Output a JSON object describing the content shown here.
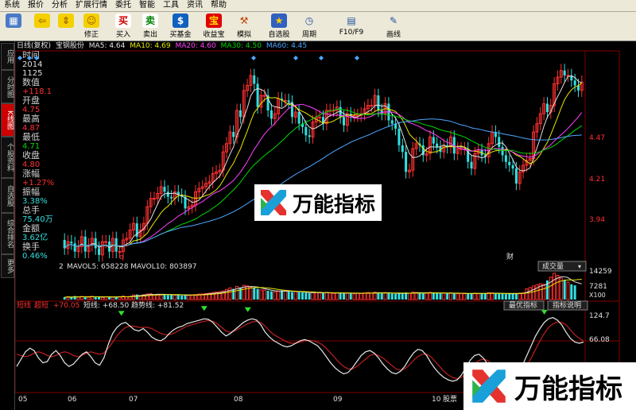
{
  "menu": [
    "系统",
    "报价",
    "分析",
    "扩展行情",
    "委托",
    "智能",
    "工具",
    "资讯",
    "帮助"
  ],
  "toolbar": [
    {
      "label": "",
      "icon": "layout-icon"
    },
    {
      "label": "",
      "icon": "back-arrow-icon"
    },
    {
      "label": "",
      "icon": "up-down-icon"
    },
    {
      "label": "修正",
      "icon": "smiley-icon"
    },
    {
      "label": "买入",
      "icon": "buy-icon"
    },
    {
      "label": "卖出",
      "icon": "sell-icon"
    },
    {
      "label": "买基金",
      "icon": "fund-icon"
    },
    {
      "label": "收益宝",
      "icon": "bao-icon"
    },
    {
      "label": "模拟",
      "icon": "hammer-icon"
    },
    {
      "label": "自选股",
      "icon": "star-icon"
    },
    {
      "label": "周期",
      "icon": "clock-icon"
    },
    {
      "label": "F10/F9",
      "icon": "grid-icon"
    },
    {
      "label": "画线",
      "icon": "pencil-icon"
    }
  ],
  "left_tabs": [
    "应用",
    "分时图",
    "K线图",
    "个股资料",
    "自选股",
    "综合排名",
    "更多"
  ],
  "ma_bar": {
    "period": "日线(复权)",
    "stock": "宝钢股份",
    "ma5": "MA5: 4.64",
    "ma10": "MA10: 4.69",
    "ma20": "MA20: 4.60",
    "ma30": "MA30: 4.50",
    "ma60": "MA60: 4.45"
  },
  "info": {
    "time_label": "时间",
    "year": "2014",
    "date": "1125",
    "value_label": "数值",
    "value": "+118.1",
    "open_label": "开盘",
    "open": "4.75",
    "high_label": "最高",
    "high": "4.87",
    "low_label": "最低",
    "low": "4.71",
    "close_label": "收盘",
    "close": "4.80",
    "change_label": "涨幅",
    "change": "+1.27%",
    "amp_label": "振幅",
    "amp": "3.38%",
    "vol_label": "总手",
    "vol": "75.40万",
    "amount_label": "金额",
    "amount": "3.62亿",
    "turnover_label": "换手",
    "turnover": "0.46%"
  },
  "price_axis": [
    "4.47",
    "4.21",
    "3.94"
  ],
  "volume_bar": {
    "index": "2",
    "mavol": "MAVOL5: 658228 MAVOL10: 803897",
    "select": "成交量",
    "axis": [
      "14259",
      "7281",
      "X100"
    ]
  },
  "indicator_bar": {
    "name": "短线",
    "name2": "超短",
    "value": "+70.05",
    "short_line": "短线: +68.50",
    "trend_line": "趋势线: +81.52",
    "btn_best": "最优指标",
    "btn_explain": "指标说明",
    "axis": [
      "124.7",
      "66.08"
    ]
  },
  "markers": {
    "q": "q",
    "cai": "财"
  },
  "x_axis": [
    "05",
    "06",
    "07",
    "08",
    "09",
    "10"
  ],
  "x_axis_tail": "股票",
  "watermark": "万能指标",
  "colors": {
    "up": "#ff3030",
    "down": "#30e0e0",
    "ma5": "#e0e0e0",
    "ma10": "#e8e800",
    "ma20": "#ff40ff",
    "ma30": "#00d800",
    "ma60": "#4da6ff"
  },
  "chart_data": {
    "type": "candlestick",
    "title": "宝钢股份",
    "ylim": [
      3.85,
      4.95
    ],
    "opens": [
      3.85,
      3.8,
      3.84,
      3.83,
      3.78,
      3.81,
      3.87,
      3.78,
      3.82,
      3.86,
      3.8,
      3.76,
      3.84,
      3.84,
      3.78,
      3.86,
      3.78,
      3.78,
      3.85,
      3.86,
      3.91,
      3.95,
      3.87,
      3.91,
      3.95,
      4.05,
      4.1,
      4.1,
      4.13,
      4.17,
      4.14,
      4.11,
      4.1,
      4.14,
      4.12,
      4.11,
      4.04,
      4.05,
      4.06,
      4.14,
      4.16,
      4.17,
      4.19,
      4.2,
      4.25,
      4.26,
      4.27,
      4.38,
      4.43,
      4.5,
      4.47,
      4.63,
      4.59,
      4.75,
      4.78,
      4.84,
      4.79,
      4.65,
      4.72,
      4.72,
      4.63,
      4.58,
      4.61,
      4.7,
      4.69,
      4.69,
      4.68,
      4.59,
      4.62,
      4.55,
      4.53,
      4.48,
      4.47,
      4.56,
      4.59,
      4.59,
      4.55,
      4.63,
      4.63,
      4.63,
      4.65,
      4.59,
      4.54,
      4.61,
      4.6,
      4.6,
      4.6,
      4.61,
      4.64,
      4.66,
      4.66,
      4.72,
      4.63,
      4.61,
      4.67,
      4.57,
      4.55,
      4.52,
      4.42,
      4.38,
      4.26,
      4.27,
      4.4,
      4.43,
      4.42,
      4.36,
      4.37,
      4.47,
      4.43,
      4.41,
      4.38,
      4.42,
      4.41,
      4.47,
      4.37,
      4.4,
      4.4,
      4.4,
      4.32,
      4.28,
      4.37,
      4.39,
      4.36,
      4.35,
      4.43,
      4.5,
      4.47,
      4.41,
      4.36,
      4.32,
      4.3,
      4.28,
      4.19,
      4.26,
      4.3,
      4.33,
      4.34,
      4.5,
      4.55,
      4.61,
      4.67,
      4.62,
      4.66,
      4.79,
      4.83,
      4.87,
      4.84,
      4.84,
      4.81,
      4.78,
      4.75
    ],
    "closes": [
      3.8,
      3.84,
      3.83,
      3.78,
      3.81,
      3.87,
      3.78,
      3.82,
      3.86,
      3.8,
      3.76,
      3.84,
      3.84,
      3.78,
      3.86,
      3.78,
      3.78,
      3.85,
      3.86,
      3.91,
      3.95,
      3.87,
      3.91,
      3.95,
      4.05,
      4.1,
      4.1,
      4.13,
      4.17,
      4.14,
      4.11,
      4.1,
      4.14,
      4.12,
      4.11,
      4.04,
      4.05,
      4.06,
      4.14,
      4.16,
      4.17,
      4.19,
      4.2,
      4.25,
      4.26,
      4.27,
      4.38,
      4.43,
      4.5,
      4.47,
      4.63,
      4.59,
      4.75,
      4.78,
      4.84,
      4.79,
      4.65,
      4.72,
      4.72,
      4.63,
      4.58,
      4.61,
      4.7,
      4.69,
      4.69,
      4.68,
      4.59,
      4.62,
      4.55,
      4.53,
      4.48,
      4.47,
      4.56,
      4.59,
      4.59,
      4.55,
      4.63,
      4.63,
      4.63,
      4.65,
      4.59,
      4.54,
      4.61,
      4.6,
      4.6,
      4.6,
      4.61,
      4.64,
      4.66,
      4.66,
      4.72,
      4.63,
      4.61,
      4.67,
      4.57,
      4.55,
      4.52,
      4.42,
      4.38,
      4.26,
      4.27,
      4.4,
      4.43,
      4.42,
      4.36,
      4.37,
      4.47,
      4.43,
      4.41,
      4.38,
      4.42,
      4.41,
      4.47,
      4.37,
      4.4,
      4.4,
      4.4,
      4.32,
      4.28,
      4.37,
      4.39,
      4.36,
      4.35,
      4.43,
      4.5,
      4.47,
      4.41,
      4.36,
      4.32,
      4.3,
      4.28,
      4.19,
      4.26,
      4.3,
      4.33,
      4.34,
      4.5,
      4.55,
      4.61,
      4.67,
      4.62,
      4.66,
      4.79,
      4.83,
      4.87,
      4.84,
      4.84,
      4.81,
      4.78,
      4.75,
      4.8
    ],
    "volumes": [
      1200,
      1500,
      1100,
      1800,
      1300,
      1600,
      1400,
      1200,
      1700,
      1300,
      1500,
      1100,
      1400,
      1600,
      1200,
      1300,
      1500,
      1800,
      1400,
      1600,
      2400,
      2600,
      2100,
      2500,
      2800,
      3000,
      2500,
      2700,
      2400,
      2800,
      2300,
      2500,
      2200,
      2600,
      2000,
      2300,
      2100,
      2400,
      2600,
      2800,
      2900,
      3100,
      3300,
      3600,
      3800,
      4000,
      4400,
      5200,
      6000,
      5500,
      6800,
      6200,
      7300,
      7000,
      6400,
      6000,
      5500,
      5000,
      4800,
      4500,
      4200,
      4000,
      4300,
      4600,
      4400,
      4200,
      3900,
      4000,
      3800,
      3600,
      3500,
      3300,
      3700,
      3600,
      3500,
      3300,
      3600,
      3400,
      3200,
      3500,
      3300,
      3100,
      3400,
      3200,
      3000,
      3300,
      3100,
      3400,
      3600,
      3300,
      3800,
      3500,
      3200,
      3600,
      3300,
      3000,
      2900,
      3100,
      3300,
      3600,
      3200,
      3800,
      3600,
      3400,
      3200,
      3300,
      3700,
      3400,
      3200,
      3100,
      3300,
      3200,
      3500,
      3100,
      3000,
      3200,
      3000,
      2900,
      3100,
      3300,
      3100,
      3000,
      3300,
      3500,
      3400,
      3100,
      3000,
      2900,
      2800,
      3200,
      3000,
      3100,
      3300,
      3400,
      5500,
      6200,
      7000,
      7600,
      8100,
      7800,
      9800,
      11500,
      13500,
      12400,
      11000,
      10200,
      9000,
      7800,
      7281
    ],
    "indicator_short": [
      40,
      52,
      64,
      70,
      66,
      54,
      46,
      48,
      60,
      66,
      58,
      46,
      40,
      44,
      52,
      60,
      64,
      56,
      46,
      42,
      54,
      76,
      94,
      104,
      110,
      112,
      106,
      100,
      98,
      102,
      96,
      88,
      84,
      82,
      86,
      94,
      100,
      104,
      106,
      110,
      112,
      114,
      116,
      118,
      117,
      112,
      104,
      96,
      90,
      94,
      100,
      106,
      112,
      116,
      118,
      116,
      108,
      96,
      88,
      82,
      78,
      74,
      72,
      74,
      78,
      82,
      84,
      82,
      78,
      74,
      66,
      56,
      46,
      38,
      32,
      28,
      30,
      38,
      48,
      58,
      64,
      66,
      62,
      54,
      44,
      36,
      30,
      28,
      32,
      40,
      52,
      62,
      68,
      66,
      58,
      46,
      36,
      28,
      22,
      18,
      16,
      18,
      26,
      38,
      50,
      58,
      60,
      54,
      44,
      34,
      26,
      20,
      16,
      14,
      18,
      28,
      42,
      58,
      74,
      90,
      102,
      112,
      118,
      120,
      116,
      108,
      96,
      86,
      80,
      78,
      80
    ],
    "indicator_trend": [
      60,
      58,
      56,
      58,
      62,
      64,
      62,
      58,
      56,
      58,
      62,
      64,
      62,
      58,
      56,
      58,
      62,
      64,
      62,
      60,
      62,
      70,
      80,
      90,
      98,
      104,
      106,
      106,
      104,
      104,
      104,
      102,
      98,
      94,
      92,
      92,
      94,
      98,
      102,
      106,
      108,
      110,
      112,
      114,
      115,
      114,
      110,
      104,
      98,
      96,
      98,
      102,
      106,
      110,
      113,
      114,
      112,
      106,
      98,
      92,
      88,
      84,
      80,
      78,
      78,
      80,
      82,
      83,
      82,
      80,
      76,
      70,
      62,
      54,
      46,
      40,
      36,
      36,
      40,
      46,
      52,
      58,
      60,
      58,
      54,
      48,
      42,
      36,
      34,
      36,
      42,
      50,
      56,
      60,
      60,
      56,
      48,
      40,
      32,
      26,
      22,
      20,
      22,
      28,
      36,
      44,
      50,
      52,
      50,
      44,
      36,
      28,
      22,
      18,
      18,
      22,
      30,
      42,
      54,
      68,
      82,
      94,
      104,
      110,
      113,
      112,
      108,
      100,
      92,
      86,
      82
    ]
  }
}
